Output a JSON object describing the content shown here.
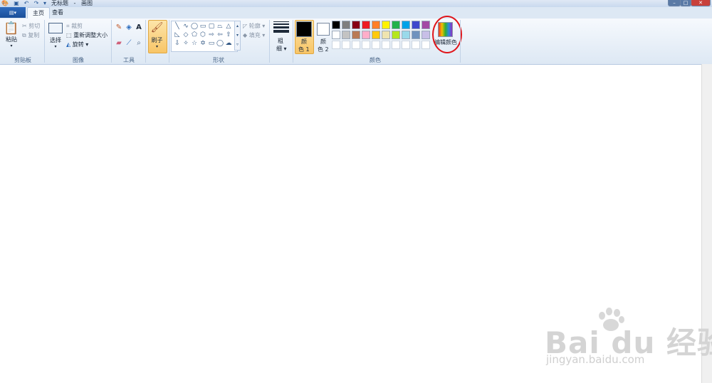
{
  "window": {
    "title": "无标题",
    "separator": "-",
    "app_name": "画图",
    "controls": {
      "minimize": "–",
      "maximize": "□",
      "close": "✕"
    }
  },
  "quick_access": {
    "save_icon": "save-icon",
    "undo_icon": "undo-icon",
    "redo_icon": "redo-icon",
    "dropdown": "▾"
  },
  "tabs": [
    {
      "label": "主页",
      "active": true
    },
    {
      "label": "查看",
      "active": false
    }
  ],
  "app_menu": {
    "glyph": "▤▾"
  },
  "groups": {
    "clipboard": {
      "label": "剪贴板",
      "paste": "粘贴",
      "cut": "剪切",
      "copy": "复制"
    },
    "image": {
      "label": "图像",
      "select": "选择",
      "crop": "裁剪",
      "resize": "重新调整大小",
      "rotate": "旋转"
    },
    "tools": {
      "label": "工具"
    },
    "brushes": {
      "label": "刷子"
    },
    "shapes": {
      "label": "形状",
      "outline": "轮廓",
      "fill": "填充"
    },
    "size": {
      "line1": "粗",
      "line2": "细"
    },
    "colors": {
      "label": "颜色",
      "color1_line1": "颜",
      "color1_line2": "色 1",
      "color2_line1": "颜",
      "color2_line2": "色 2",
      "edit_colors": "编辑颜色",
      "color1_value": "#000000",
      "color2_value": "#ffffff",
      "palette_row1": [
        "#000000",
        "#7f7f7f",
        "#880015",
        "#ed1c24",
        "#ff7f27",
        "#fff200",
        "#22b14c",
        "#00a2e8",
        "#3f48cc",
        "#a349a4"
      ],
      "palette_row2": [
        "#ffffff",
        "#c3c3c3",
        "#b97a57",
        "#ffaec9",
        "#ffc90e",
        "#efe4b0",
        "#b5e61d",
        "#99d9ea",
        "#7092be",
        "#c8bfe7"
      ],
      "palette_row3": [
        "#ffffff",
        "#ffffff",
        "#ffffff",
        "#ffffff",
        "#ffffff",
        "#ffffff",
        "#ffffff",
        "#ffffff",
        "#ffffff",
        "#ffffff"
      ]
    }
  },
  "annotation": {
    "color": "#e0141a"
  },
  "watermark": {
    "logo": "Bai du 经验",
    "url": "jingyan.baidu.com"
  }
}
